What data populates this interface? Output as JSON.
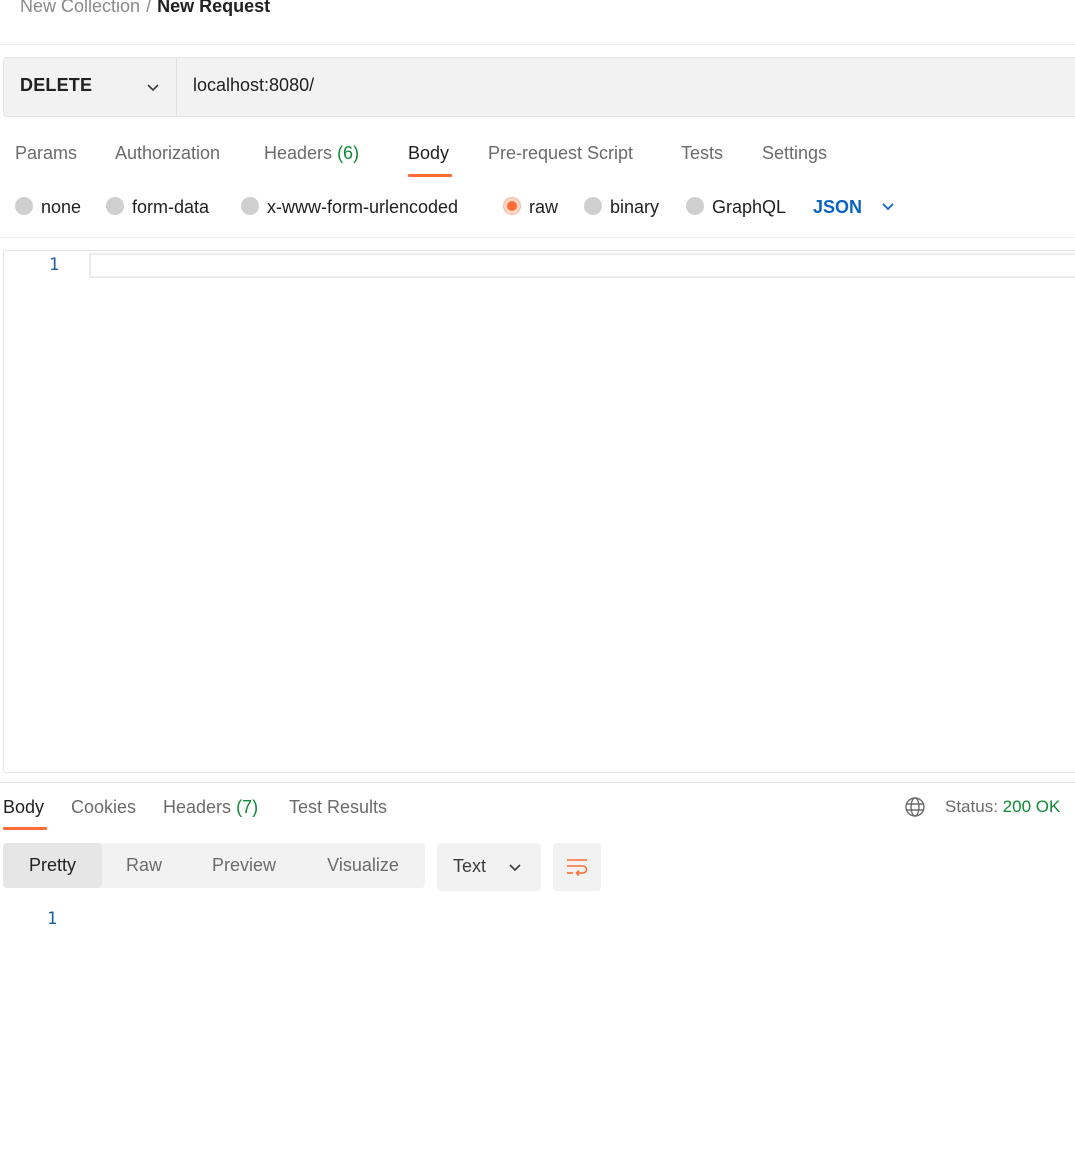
{
  "breadcrumb": {
    "collection": "New Collection",
    "separator": "/",
    "request": "New Request"
  },
  "request": {
    "method": "DELETE",
    "url": "localhost:8080/"
  },
  "request_tabs": [
    {
      "label": "Params"
    },
    {
      "label": "Authorization"
    },
    {
      "label": "Headers",
      "count": "(6)"
    },
    {
      "label": "Body",
      "active": true
    },
    {
      "label": "Pre-request Script"
    },
    {
      "label": "Tests"
    },
    {
      "label": "Settings"
    }
  ],
  "body_types": [
    {
      "label": "none"
    },
    {
      "label": "form-data"
    },
    {
      "label": "x-www-form-urlencoded"
    },
    {
      "label": "raw",
      "selected": true
    },
    {
      "label": "binary"
    },
    {
      "label": "GraphQL"
    }
  ],
  "body_format": "JSON",
  "editor": {
    "line_numbers": [
      "1"
    ]
  },
  "response": {
    "tabs": [
      {
        "label": "Body",
        "active": true
      },
      {
        "label": "Cookies"
      },
      {
        "label": "Headers",
        "count": "(7)"
      },
      {
        "label": "Test Results"
      }
    ],
    "status_label": "Status:",
    "status_value": "200 OK",
    "view_modes": [
      "Pretty",
      "Raw",
      "Preview",
      "Visualize"
    ],
    "active_view_mode": "Pretty",
    "format": "Text",
    "line_numbers": [
      "1"
    ]
  },
  "colors": {
    "accent": "#ff6c37",
    "link_blue": "#0b63c5",
    "success_green": "#0f8a36"
  }
}
